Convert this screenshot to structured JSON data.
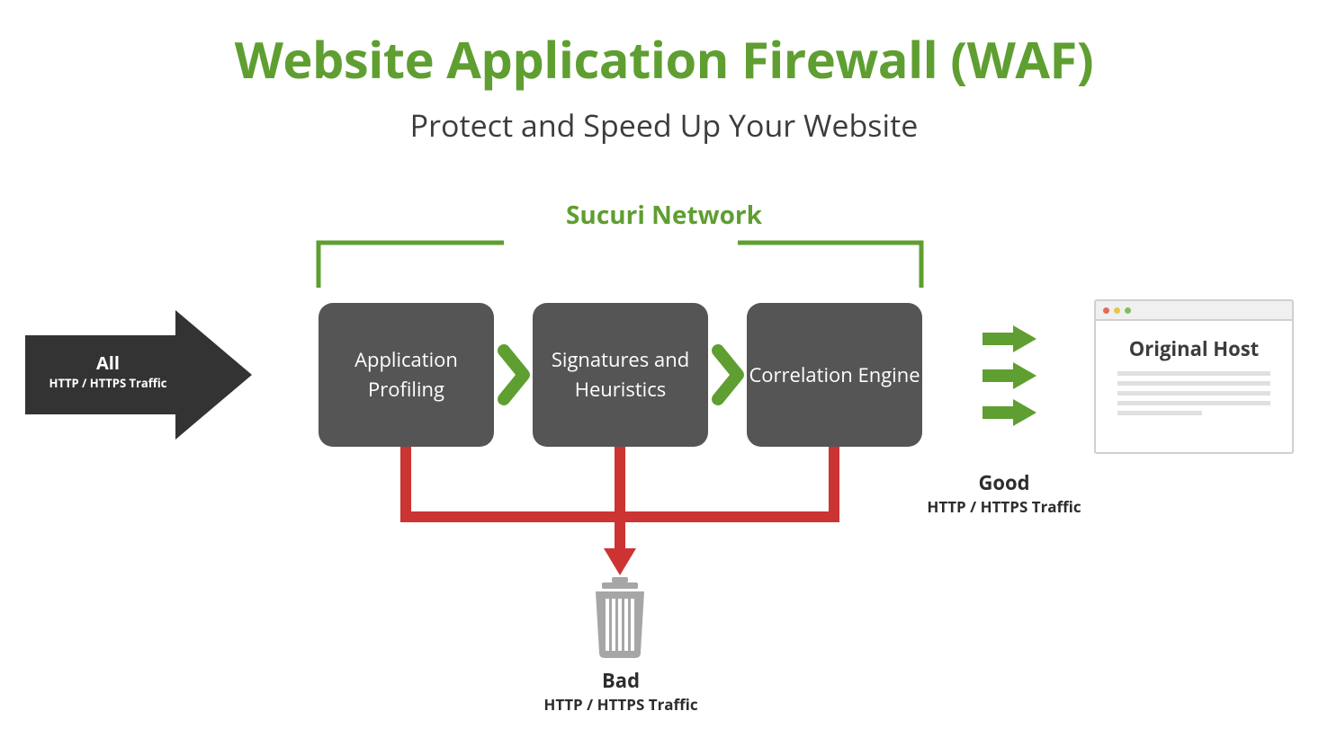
{
  "title": "Website Application Firewall (WAF)",
  "subtitle": "Protect and Speed Up Your Website",
  "network_label": "Sucuri Network",
  "input_arrow": {
    "line1": "All",
    "line2": "HTTP / HTTPS Traffic"
  },
  "stages": [
    "Application Profiling",
    "Signatures and Heuristics",
    "Correlation Engine"
  ],
  "output_good": {
    "line1": "Good",
    "line2": "HTTP / HTTPS Traffic"
  },
  "output_bad": {
    "line1": "Bad",
    "line2": "HTTP / HTTPS Traffic"
  },
  "original_host": "Original Host",
  "colors": {
    "green": "#5F9E31",
    "dark_box": "#555555",
    "arrow_dark": "#333333",
    "red": "#CC3333",
    "grey_icon": "#a6a6a6",
    "dot_red": "#e06c5c",
    "dot_yellow": "#e8c54b",
    "dot_green": "#7fbf5a"
  }
}
